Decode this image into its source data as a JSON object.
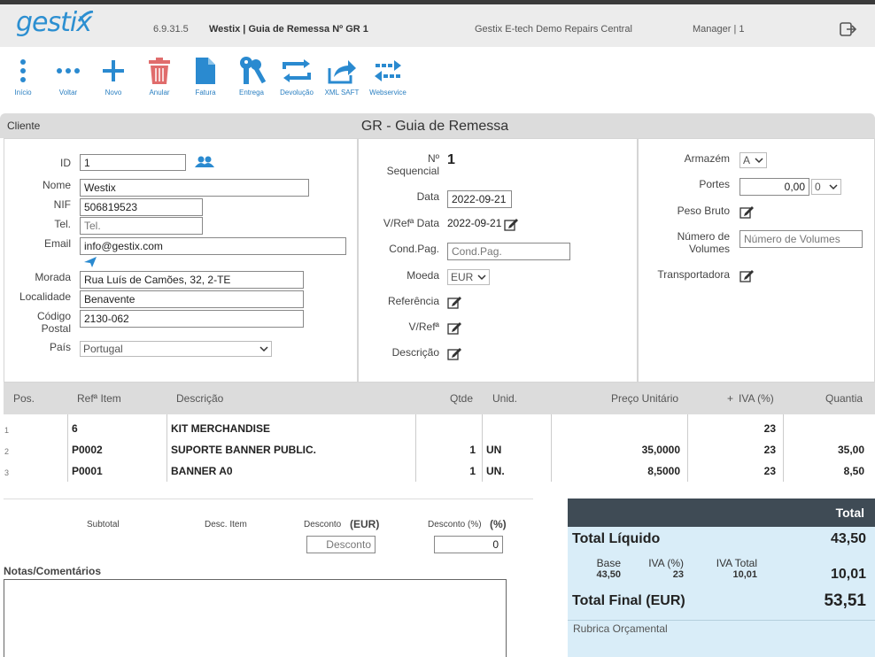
{
  "app": {
    "logo": "gestix",
    "version": "6.9.31.5",
    "doc_title": "Westix | Guia de Remessa Nº GR 1",
    "company": "Gestix E-tech Demo Repairs Central",
    "user": "Manager | 1"
  },
  "toolbar": [
    {
      "label": "Início",
      "icon": "vertical-dots-icon"
    },
    {
      "label": "Voltar",
      "icon": "horizontal-dots-icon"
    },
    {
      "label": "Novo",
      "icon": "plus-icon"
    },
    {
      "label": "Anular",
      "icon": "trash-icon"
    },
    {
      "label": "Fatura",
      "icon": "document-icon"
    },
    {
      "label": "Entrega",
      "icon": "keys-icon"
    },
    {
      "label": "Devolução",
      "icon": "return-arrows-icon"
    },
    {
      "label": "XML SAFT",
      "icon": "share-icon"
    },
    {
      "label": "Webservice",
      "icon": "exchange-arrows-icon"
    }
  ],
  "panel": {
    "cliente": "Cliente",
    "title": "GR - Guia de Remessa"
  },
  "client": {
    "id_label": "ID",
    "id_value": "1",
    "nome_label": "Nome",
    "nome_value": "Westix",
    "nif_label": "NIF",
    "nif_value": "506819523",
    "tel_label": "Tel.",
    "tel_placeholder": "Tel.",
    "email_label": "Email",
    "email_value": "info@gestix.com",
    "morada_label": "Morada",
    "morada_value": "Rua Luís de Camões, 32, 2-TE",
    "localidade_label": "Localidade",
    "localidade_value": "Benavente",
    "codigo_label_1": "Código",
    "codigo_label_2": "Postal",
    "codigo_value": "2130-062",
    "pais_label": "País",
    "pais_value": "Portugal"
  },
  "doc": {
    "seq_label_1": "Nº",
    "seq_label_2": "Sequencial",
    "seq_value": "1",
    "data_label": "Data",
    "data_value": "2022-09-21",
    "vref_data_label": "V/Refª Data",
    "vref_data_value": "2022-09-21",
    "cond_label": "Cond.Pag.",
    "cond_placeholder": "Cond.Pag.",
    "moeda_label": "Moeda",
    "moeda_value": "EUR",
    "referencia_label": "Referência",
    "vref_label": "V/Refª",
    "descricao_label": "Descrição"
  },
  "shipping": {
    "armazem_label": "Armazém",
    "armazem_value": "A",
    "portes_label": "Portes",
    "portes_value": "0,00",
    "portes_rate": "0",
    "peso_label": "Peso Bruto",
    "volumes_label_1": "Número de",
    "volumes_label_2": "Volumes",
    "volumes_placeholder": "Número de Volumes",
    "transportadora_label": "Transportadora"
  },
  "table": {
    "headers": {
      "pos": "Pos.",
      "ref": "Refª Item",
      "desc": "Descrição",
      "qtde": "Qtde",
      "unid": "Unid.",
      "preco": "Preço Unitário",
      "iva_plus": "+",
      "iva": "IVA (%)",
      "quantia": "Quantia"
    },
    "rows": [
      {
        "pos": "1",
        "ref": "6",
        "desc": "KIT MERCHANDISE",
        "qtde": "",
        "unid": "",
        "preco": "",
        "iva": "23",
        "quantia": ""
      },
      {
        "pos": "2",
        "ref": "P0002",
        "desc": "SUPORTE BANNER PUBLIC.",
        "qtde": "1",
        "unid": "UN",
        "preco": "35,0000",
        "iva": "23",
        "quantia": "35,00"
      },
      {
        "pos": "3",
        "ref": "P0001",
        "desc": "BANNER A0",
        "qtde": "1",
        "unid": "UN.",
        "preco": "8,5000",
        "iva": "23",
        "quantia": "8,50"
      }
    ]
  },
  "summary": {
    "subtotal_label": "Subtotal",
    "desc_item_label": "Desc. Item",
    "desconto_label": "Desconto",
    "desconto_unit": "(EUR)",
    "desconto_placeholder": "Desconto",
    "desconto_pct_label": "Desconto (%)",
    "desconto_pct_unit": "(%)",
    "desconto_pct_value": "0",
    "notas_label": "Notas/Comentários"
  },
  "totals": {
    "header": "Total",
    "liquido_label": "Total Líquido",
    "liquido_value": "43,50",
    "base_label": "Base",
    "base_value": "43,50",
    "iva_pct_label": "IVA (%)",
    "iva_pct_value": "23",
    "iva_total_label": "IVA Total",
    "iva_total_value": "10,01",
    "iva_sum": "10,01",
    "final_label": "Total Final (EUR)",
    "final_value": "53,51",
    "rubrica_label": "Rubrica Orçamental"
  }
}
